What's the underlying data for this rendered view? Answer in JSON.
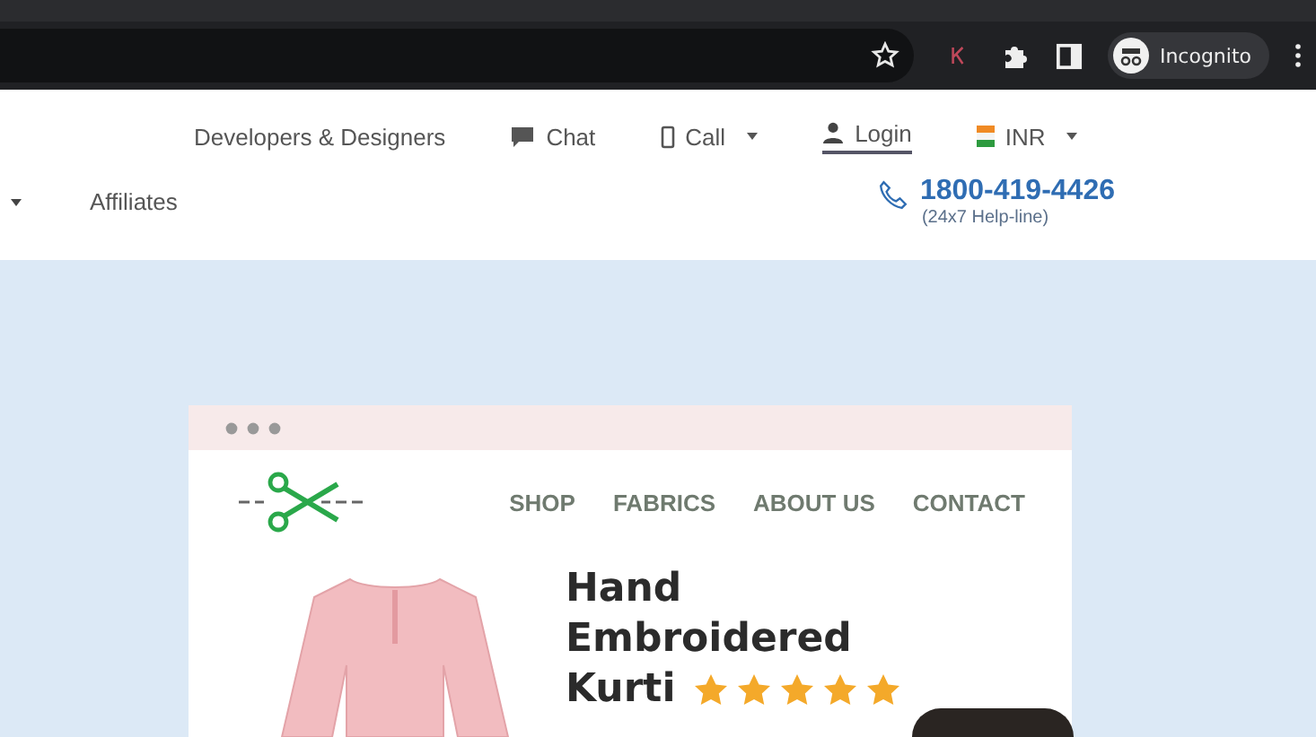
{
  "browser": {
    "profile_label": "Incognito"
  },
  "top_nav": {
    "items": [
      {
        "kind": "text",
        "label": "Developers & Designers"
      },
      {
        "kind": "chat",
        "label": "Chat"
      },
      {
        "kind": "call",
        "label": "Call"
      },
      {
        "kind": "login",
        "label": "Login"
      },
      {
        "kind": "currency",
        "label": "INR"
      }
    ]
  },
  "sub_nav": {
    "affiliates": "Affiliates",
    "phone": "1800-419-4426",
    "phone_note": "(24x7 Help-line)"
  },
  "preview": {
    "nav": [
      "SHOP",
      "FABRICS",
      "ABOUT US",
      "CONTACT"
    ],
    "title_lines": [
      "Hand",
      "Embroidered",
      "Kurti"
    ],
    "stars": 5
  }
}
